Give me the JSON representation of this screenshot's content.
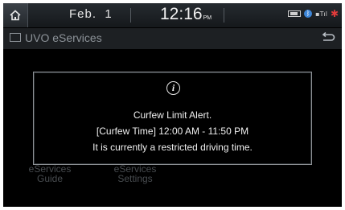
{
  "status_bar": {
    "date": "Feb.  1",
    "time": "12:16",
    "ampm": "PM",
    "icons": [
      "battery-icon",
      "bluetooth-icon",
      "signal-icon",
      "alert-icon"
    ]
  },
  "header": {
    "title": "UVO eServices"
  },
  "menu": [
    {
      "label_line1": "eServices",
      "label_line2": "Guide",
      "icon": "guide-icon"
    },
    {
      "label_line1": "eServices",
      "label_line2": "Settings",
      "icon": "settings-icon"
    }
  ],
  "popup": {
    "icon": "info-icon",
    "line1": "Curfew Limit Alert.",
    "line2": "[Curfew Time] 12:00 AM - 11:50 PM",
    "line3": "It is currently a restricted driving time."
  },
  "colors": {
    "background": "#000000",
    "text": "#f0f0f0",
    "muted": "#8c9298",
    "accent_alert": "#e23b3b",
    "bluetooth": "#3d86d8"
  }
}
